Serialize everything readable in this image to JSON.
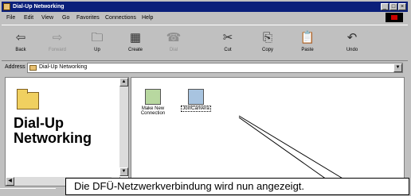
{
  "window": {
    "title": "Dial-Up Networking"
  },
  "menu": [
    "File",
    "Edit",
    "View",
    "Go",
    "Favorites",
    "Connections",
    "Help"
  ],
  "toolbar": [
    {
      "label": "Back",
      "glyph": "⇦",
      "disabled": false
    },
    {
      "label": "Forward",
      "glyph": "⇨",
      "disabled": true
    },
    {
      "label": "Up",
      "glyph": "🗀",
      "disabled": false
    },
    {
      "label": "Create",
      "glyph": "▦",
      "disabled": false
    },
    {
      "label": "Dial",
      "glyph": "☎",
      "disabled": true
    },
    {
      "label": "Cut",
      "glyph": "✂",
      "disabled": false
    },
    {
      "label": "Copy",
      "glyph": "⎘",
      "disabled": false
    },
    {
      "label": "Paste",
      "glyph": "📋",
      "disabled": false
    },
    {
      "label": "Undo",
      "glyph": "↶",
      "disabled": false
    }
  ],
  "address": {
    "label": "Address",
    "value": "Dial-Up Networking"
  },
  "left_panel": {
    "title": "Dial-Up Networking"
  },
  "files": [
    {
      "label": "Make New Connection",
      "icon": "make-new-connection-icon"
    },
    {
      "label": "JoinCanvera",
      "icon": "connection-icon"
    }
  ],
  "callout": {
    "text": "Die DFÜ-Netzwerkverbindung wird nun angezeigt."
  },
  "colors": {
    "title_bar": "#0a1f7a",
    "chrome": "#c0c0c0"
  }
}
